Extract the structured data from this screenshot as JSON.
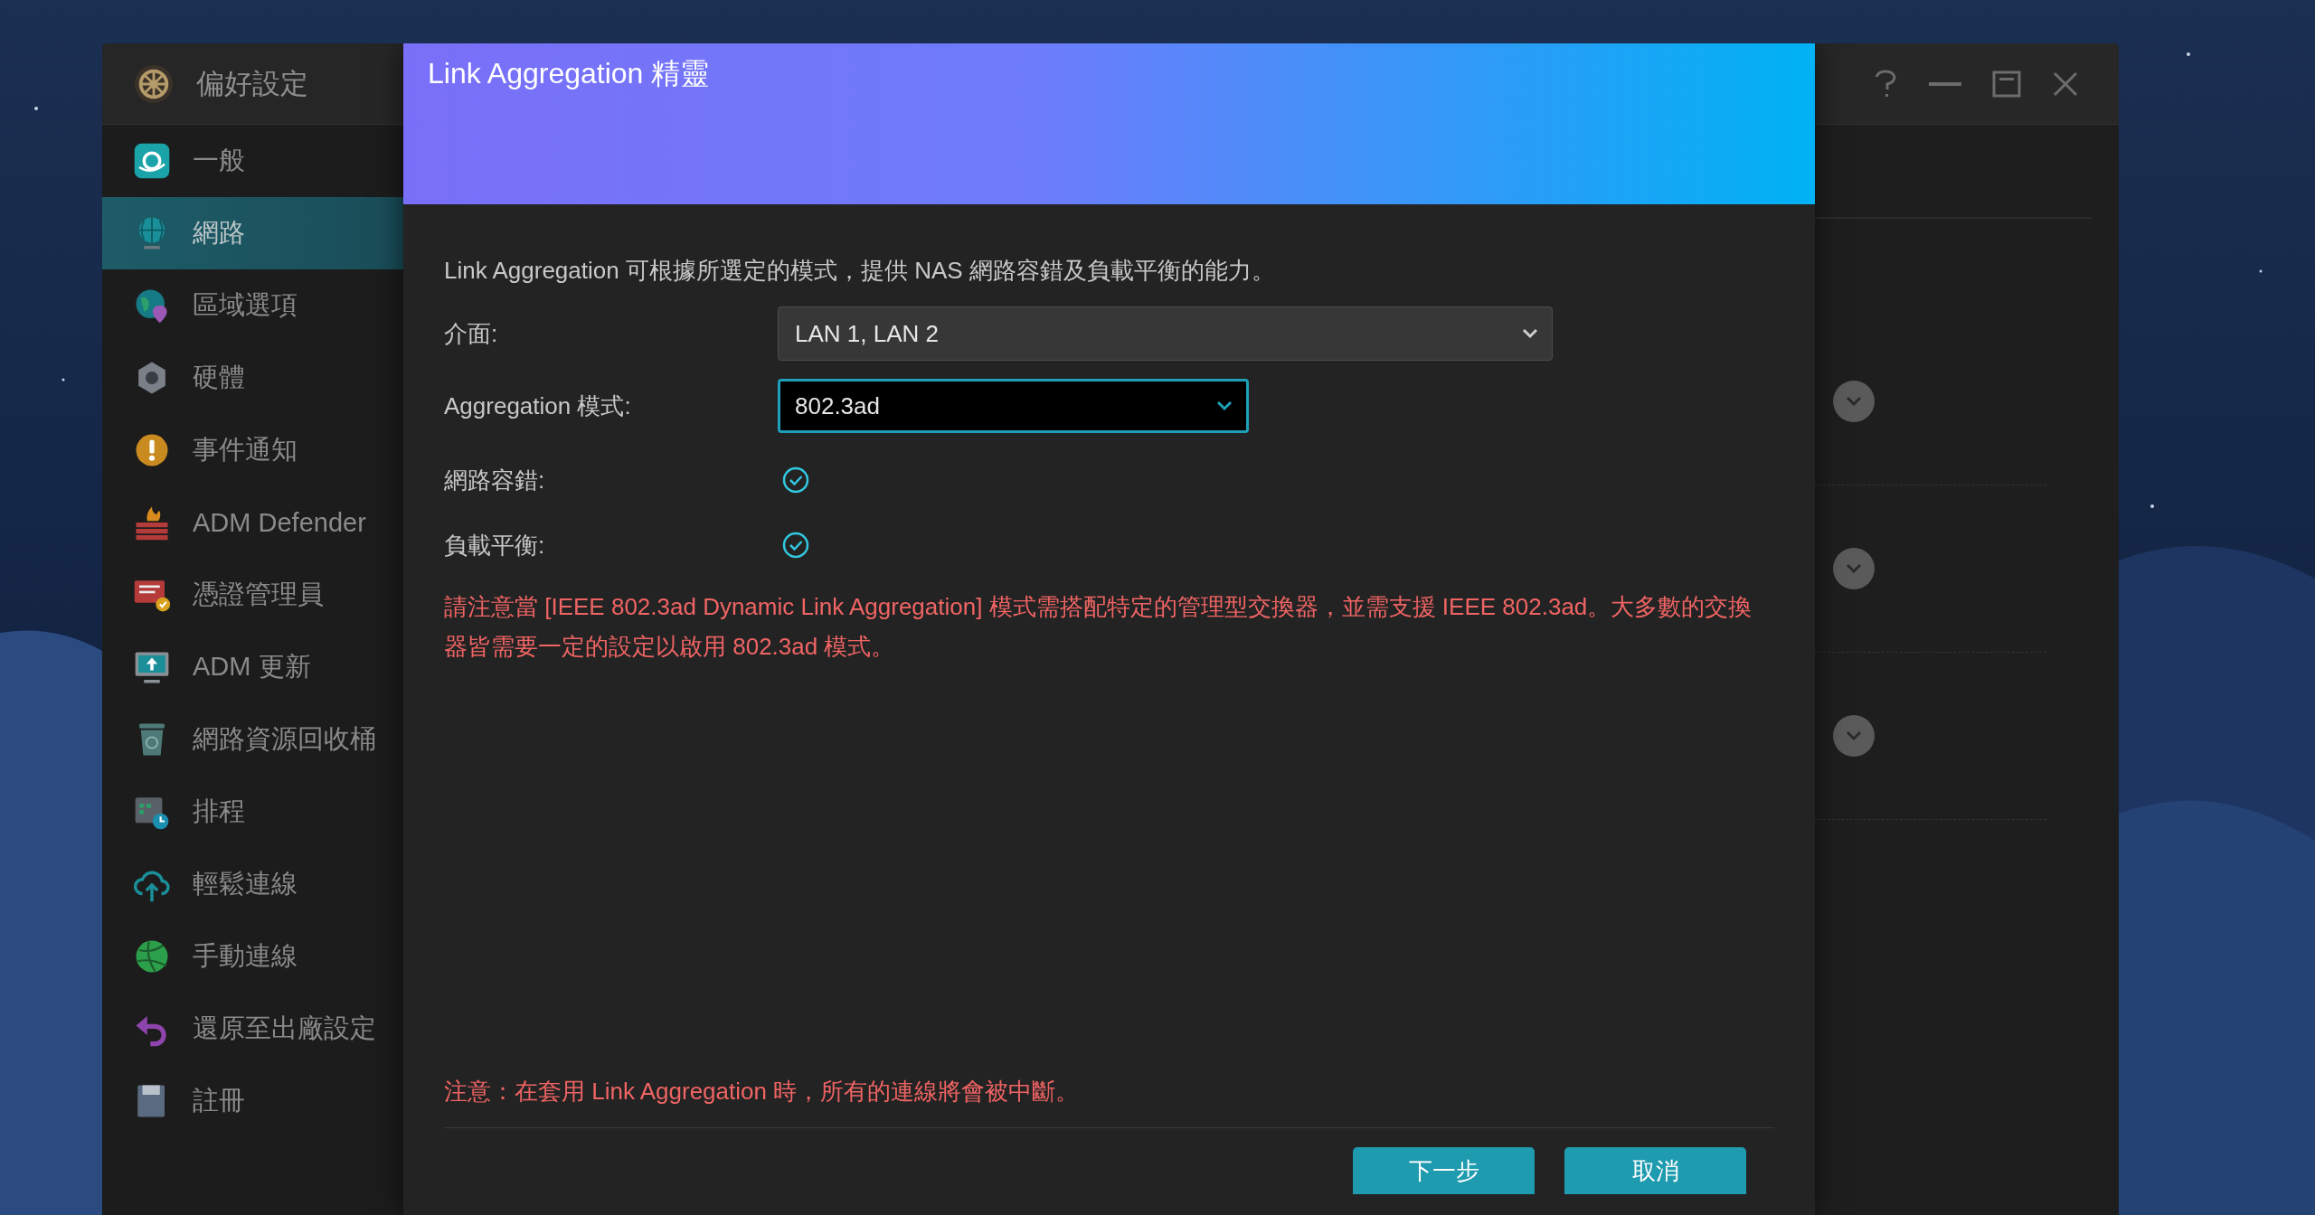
{
  "window": {
    "title": "偏好設定"
  },
  "sidebar": {
    "items": [
      {
        "label": "一般",
        "selected": false
      },
      {
        "label": "網路",
        "selected": true
      },
      {
        "label": "區域選項",
        "selected": false
      },
      {
        "label": "硬體",
        "selected": false
      },
      {
        "label": "事件通知",
        "selected": false
      },
      {
        "label": "ADM Defender",
        "selected": false
      },
      {
        "label": "憑證管理員",
        "selected": false
      },
      {
        "label": "ADM 更新",
        "selected": false
      },
      {
        "label": "網路資源回收桶",
        "selected": false
      },
      {
        "label": "排程",
        "selected": false
      },
      {
        "label": "輕鬆連線",
        "selected": false
      },
      {
        "label": "手動連線",
        "selected": false
      },
      {
        "label": "還原至出廠設定",
        "selected": false
      },
      {
        "label": "註冊",
        "selected": false
      }
    ]
  },
  "dialog": {
    "title": "Link Aggregation 精靈",
    "description": "Link Aggregation 可根據所選定的模式，提供 NAS 網路容錯及負載平衡的能力。",
    "fields": [
      {
        "kind": "select",
        "label": "介面:",
        "value": "LAN 1, LAN 2",
        "focused": false
      },
      {
        "kind": "select",
        "label": "Aggregation 模式:",
        "value": "802.3ad",
        "focused": true
      },
      {
        "kind": "check",
        "label": "網路容錯:",
        "checked": true
      },
      {
        "kind": "check",
        "label": "負載平衡:",
        "checked": true
      }
    ],
    "warning": "請注意當 [IEEE 802.3ad Dynamic Link Aggregation] 模式需搭配特定的管理型交換器，並需支援 IEEE 802.3ad。大多數的交換器皆需要一定的設定以啟用 802.3ad 模式。",
    "note": "注意：在套用 Link Aggregation 時，所有的連線將會被中斷。",
    "buttons": [
      "下一步",
      "取消"
    ]
  }
}
